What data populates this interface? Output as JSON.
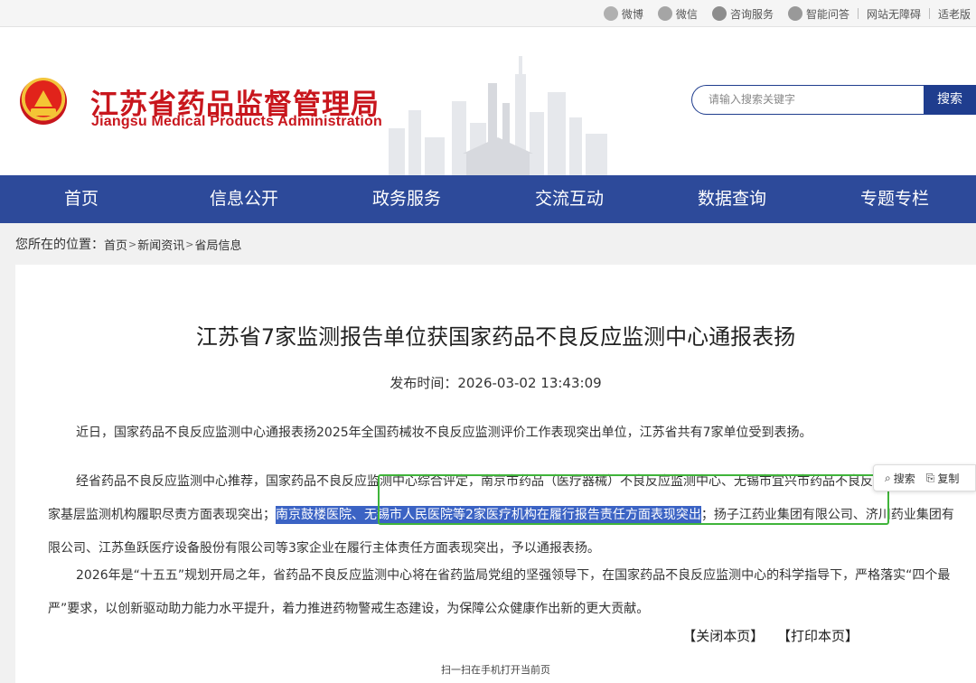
{
  "topbar": {
    "links": [
      {
        "label": "微博",
        "icon": "weibo-icon"
      },
      {
        "label": "微信",
        "icon": "wechat-icon"
      },
      {
        "label": "咨询服务",
        "icon": "chat-icon"
      },
      {
        "label": "智能问答",
        "icon": "robot-icon"
      }
    ],
    "accessibility": "网站无障碍",
    "elder": "适老版"
  },
  "header": {
    "brand_cn": "江苏省药品监督管理局",
    "brand_en": "Jiangsu Medical Products Administration",
    "search_placeholder": "请输入搜索关键字",
    "search_button": "搜索"
  },
  "nav": [
    "首页",
    "信息公开",
    "政务服务",
    "交流互动",
    "数据查询",
    "专题专栏"
  ],
  "breadcrumb": {
    "label": "您所在的位置：",
    "items": [
      "首页",
      "新闻资讯",
      "省局信息"
    ]
  },
  "article": {
    "title": "江苏省7家监测报告单位获国家药品不良反应监测中心通报表扬",
    "pubtime": "发布时间：2026-03-02 13:43:09",
    "p1": "近日，国家药品不良反应监测中心通报表扬2025年全国药械妆不良反应监测评价工作表现突出单位，江苏省共有7家单位受到表扬。",
    "p2_before": "经省药品不良反应监测中心推荐，国家药品不良反应监测中心综合评定，南京市药品（医疗器械）不良反应监测中心、无锡市宜兴市药品不良反应监测中心等2家基层监测机构履职尽责方面表现突出；",
    "p2_highlight": "南京鼓楼医院、无锡市人民医院等2家医疗机构在履行报告责任方面表现突出",
    "p2_after": "；扬子江药业集团有限公司、济川药业集团有限公司、江苏鱼跃医疗设备股份有限公司等3家企业在履行主体责任方面表现突出，予以通报表扬。",
    "p3": "2026年是“十五五”规划开局之年，省药品不良反应监测中心将在省药监局党组的坚强领导下，在国家药品不良反应监测中心的科学指导下，严格落实“四个最严”要求，以创新驱动助力能力水平提升，着力推进药物警戒生态建设，为保障公众健康作出新的更大贡献。",
    "close": "【关闭本页】",
    "print": "【打印本页】",
    "scan": "扫一扫在手机打开当前页"
  },
  "floatbar": {
    "search": "搜索",
    "copy": "复制"
  },
  "colors": {
    "brand_red": "#c8161d",
    "nav_blue": "#2d4a9a",
    "highlight": "#3b63c4",
    "annotation_green": "#3fb43a"
  }
}
